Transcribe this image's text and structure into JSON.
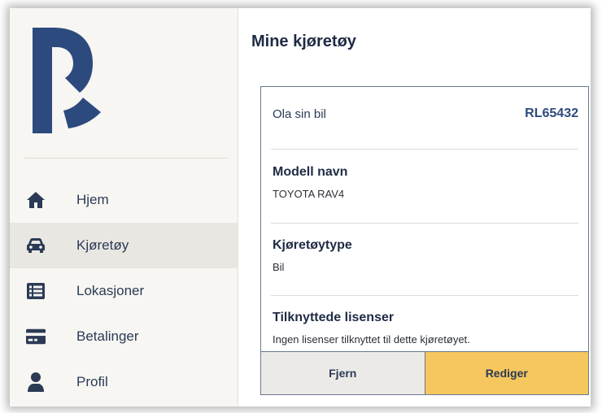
{
  "sidebar": {
    "logo_text": "P",
    "items": [
      {
        "label": "Hjem",
        "icon": "home-icon",
        "active": false
      },
      {
        "label": "Kjøretøy",
        "icon": "car-icon",
        "active": true
      },
      {
        "label": "Lokasjoner",
        "icon": "list-icon",
        "active": false
      },
      {
        "label": "Betalinger",
        "icon": "credit-card-icon",
        "active": false
      },
      {
        "label": "Profil",
        "icon": "user-icon",
        "active": false
      }
    ]
  },
  "main": {
    "title": "Mine kjøretøy",
    "vehicle": {
      "name": "Ola sin bil",
      "registration": "RL65432",
      "model_label": "Modell navn",
      "model_value": "TOYOTA RAV4",
      "type_label": "Kjøretøytype",
      "type_value": "Bil",
      "licenses_label": "Tilknyttede lisenser",
      "licenses_value": "Ingen lisenser tilknyttet til dette kjøretøyet.",
      "remove_label": "Fjern",
      "edit_label": "Rediger"
    }
  },
  "colors": {
    "brand": "#2d4a7e",
    "accent": "#f5c75e",
    "sidebar_bg": "#f7f6f3",
    "active_item_bg": "#e9e7e2"
  }
}
